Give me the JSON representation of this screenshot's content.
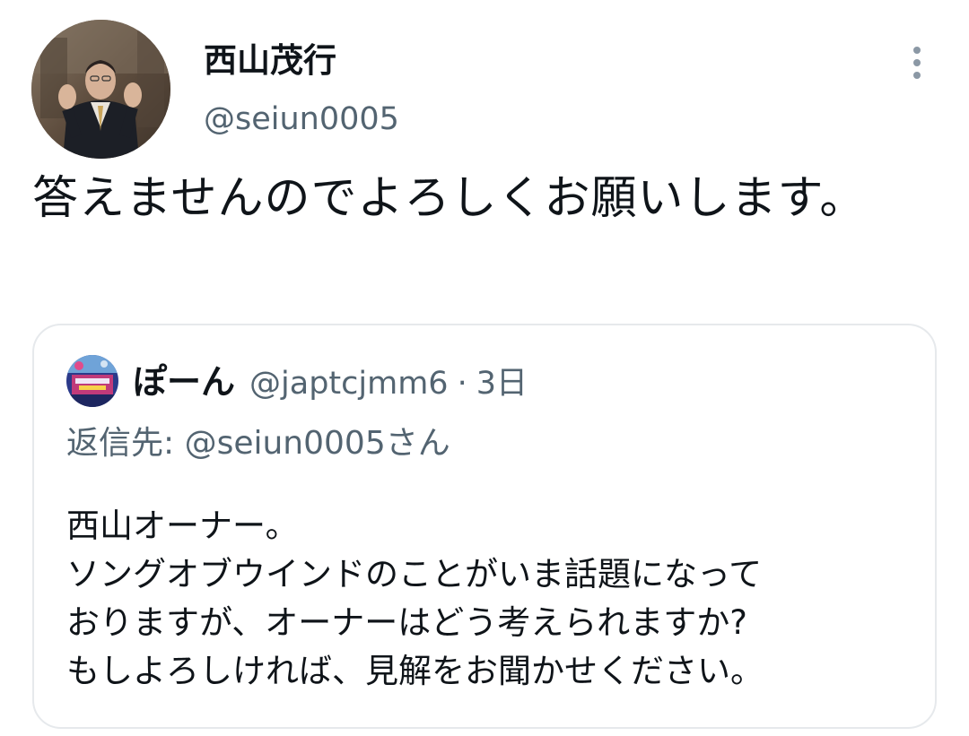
{
  "tweet": {
    "author": {
      "display_name": "西山茂行",
      "handle": "@seiun0005"
    },
    "text": "答えませんのでよろしくお願いします。"
  },
  "quoted_tweet": {
    "author": {
      "display_name": "ぽーん",
      "handle": "@japtcjmm6"
    },
    "separator": "·",
    "time": "3日",
    "reply_to": {
      "label": "返信先: ",
      "mention": "@seiun0005さん"
    },
    "lines": [
      "西山オーナー。",
      "ソングオブウインドのことがいま話題になって",
      "おりますが、オーナーはどう考えられますか?",
      "もしよろしければ、見解をお聞かせください。"
    ]
  },
  "colors": {
    "text_primary": "#0f1419",
    "text_secondary": "#536471",
    "border": "#e6e9ec",
    "more_icon": "#8b98a5"
  },
  "icons": {
    "more": "vertical-ellipsis-icon"
  }
}
